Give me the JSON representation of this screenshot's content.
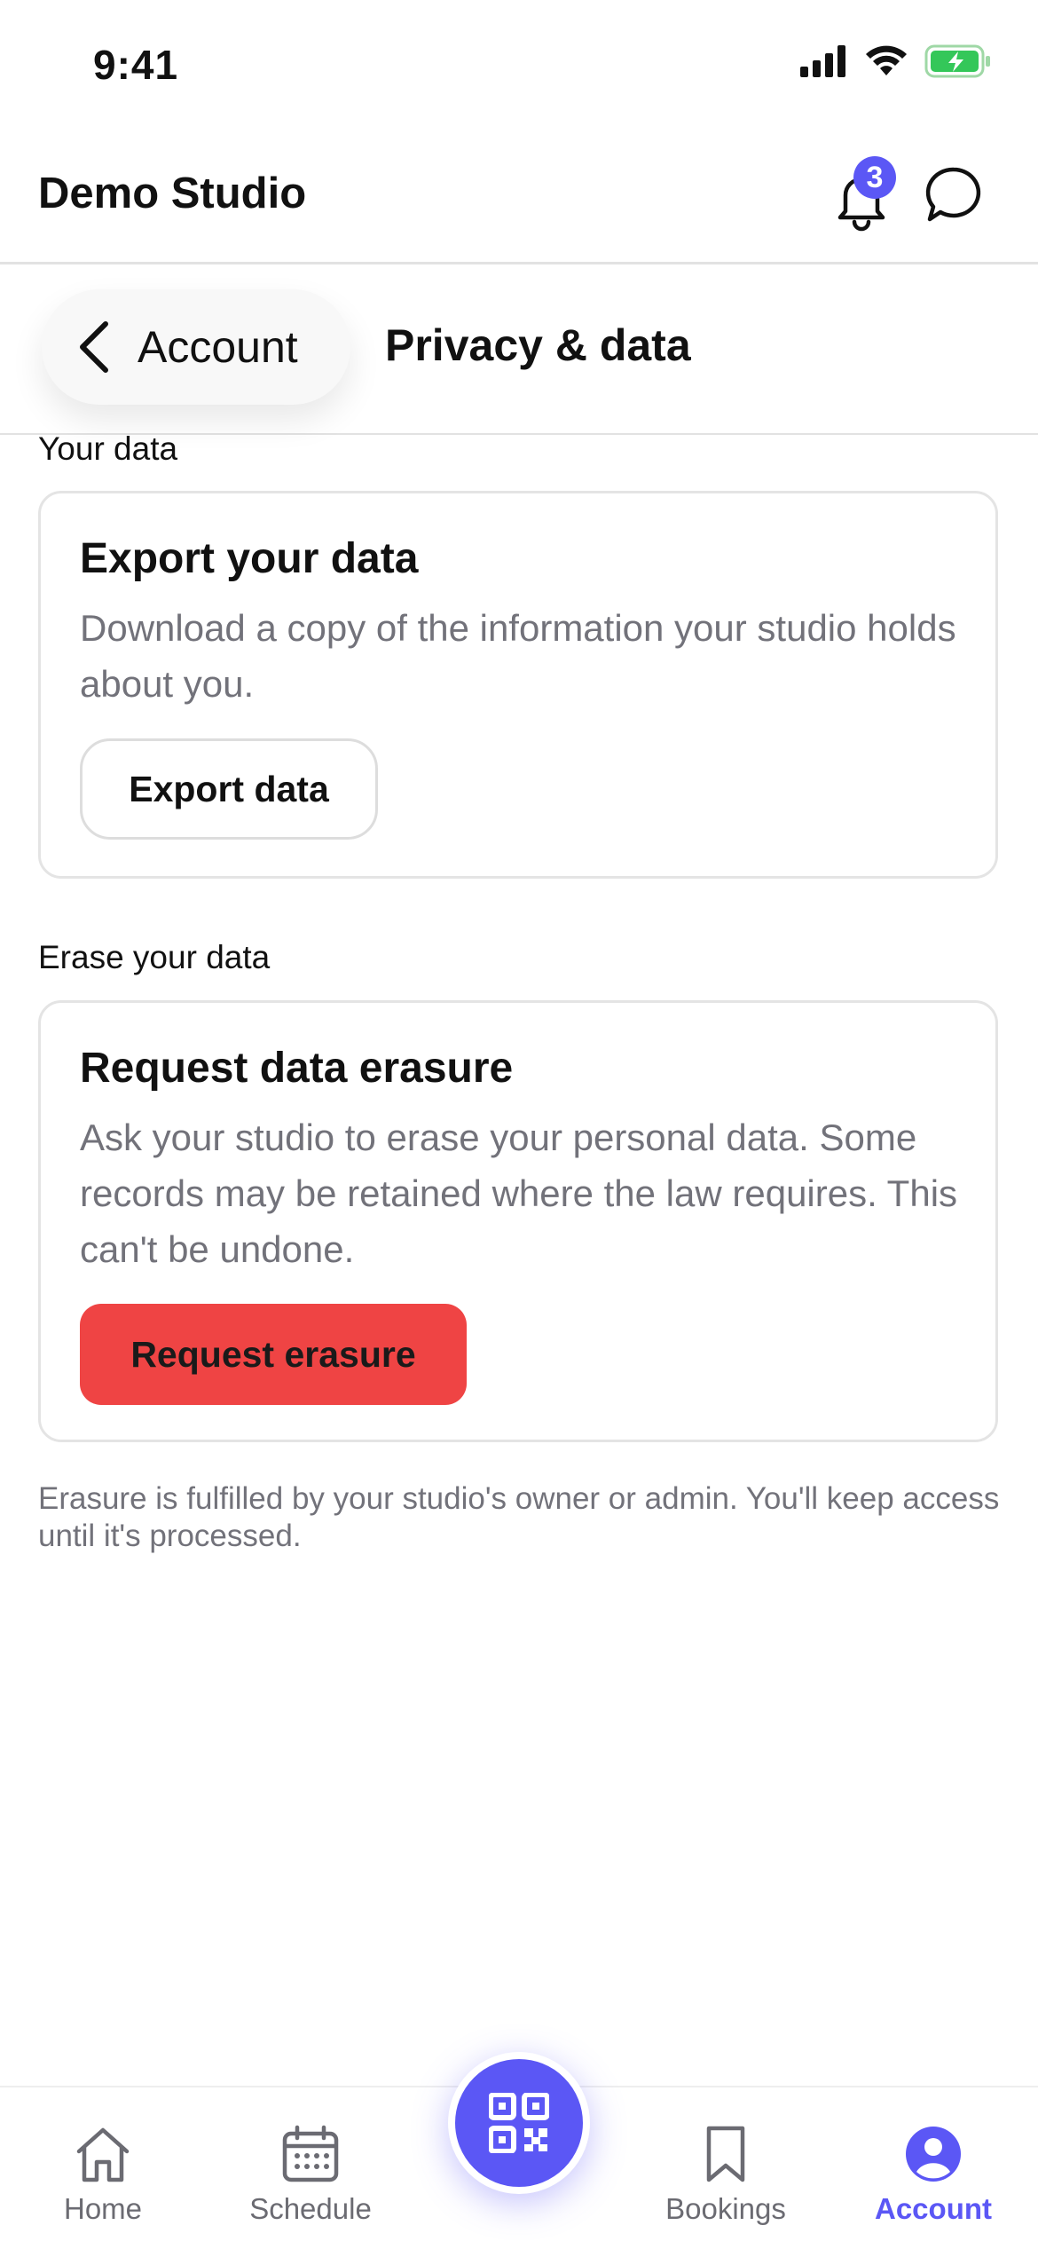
{
  "status": {
    "time": "9:41"
  },
  "header": {
    "studio_name": "Demo Studio",
    "notifications_count": "3"
  },
  "nav": {
    "back_label": "Account",
    "page_title": "Privacy & data"
  },
  "sections": {
    "your_data": {
      "heading": "Your data",
      "card_title": "Export your data",
      "card_desc": "Download a copy of the information your studio holds about you.",
      "button": "Export data"
    },
    "erase": {
      "heading": "Erase your data",
      "card_title": "Request data erasure",
      "card_desc": "Ask your studio to erase your personal data. Some records may be retained where the law requires. This can't be undone.",
      "button": "Request erasure"
    }
  },
  "footnote": "Erasure is fulfilled by your studio's owner or admin. You'll keep access until it's processed.",
  "tabs": [
    {
      "label": "Home",
      "icon": "home-icon"
    },
    {
      "label": "Schedule",
      "icon": "calendar-icon"
    },
    {
      "label": "Bookings",
      "icon": "bookmark-icon"
    },
    {
      "label": "Account",
      "icon": "user-icon",
      "active": true
    }
  ],
  "colors": {
    "accent": "#5b57f5",
    "danger": "#ef4444",
    "muted": "#72727a"
  }
}
